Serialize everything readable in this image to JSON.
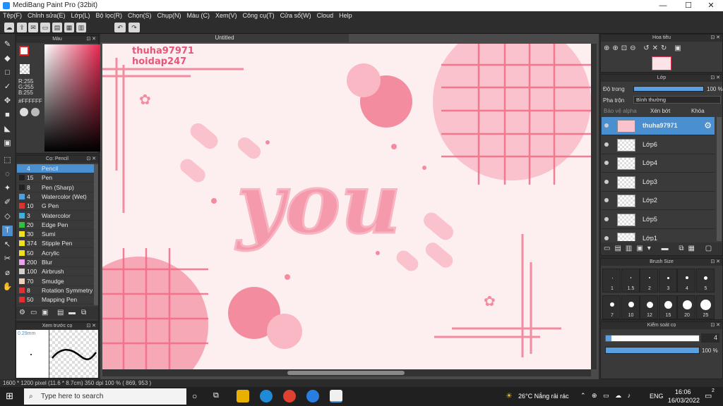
{
  "window": {
    "title": "MediBang Paint Pro (32bit)",
    "min": "—",
    "max": "☐",
    "close": "✕"
  },
  "menu": [
    "Tệp(F)",
    "Chỉnh sửa(E)",
    "Lớp(L)",
    "Bộ lọc(R)",
    "Chọn(S)",
    "Chụp(N)",
    "Màu (C)",
    "Xem(V)",
    "Công cụ(T)",
    "Cửa sổ(W)",
    "Cloud",
    "Help"
  ],
  "panels": {
    "color": {
      "title": "Màu",
      "r": "R:255",
      "g": "G:255",
      "b": "B:255",
      "hex": "#FFFFFF"
    },
    "brush": {
      "title": "Cọ: Pencil"
    },
    "preview": {
      "title": "Xem trước cọ",
      "size": "0.29mm"
    },
    "navigator": {
      "title": "Hoa tiêu"
    },
    "layer": {
      "title": "Lớp",
      "opacity_label": "Độ trong",
      "opacity_value": "100 %",
      "blend_label": "Pha trộn",
      "blend_value": "Bình thường",
      "protect_alpha": "Bảo vệ alpha",
      "clip": "Xén bớt",
      "lock": "Khóa"
    },
    "brushsize": {
      "title": "Brush Size"
    },
    "control": {
      "title": "Kiểm soát cọ",
      "size_value": "4",
      "opacity_value": "100 %"
    }
  },
  "brushes": [
    {
      "size": "4",
      "name": "Pencil",
      "color": "#4a90d0"
    },
    {
      "size": "15",
      "name": "Pen",
      "color": "#222222"
    },
    {
      "size": "8",
      "name": "Pen (Sharp)",
      "color": "#222222"
    },
    {
      "size": "4",
      "name": "Watercolor (Wet)",
      "color": "#4aa0e0"
    },
    {
      "size": "10",
      "name": "G Pen",
      "color": "#e03030"
    },
    {
      "size": "3",
      "name": "Watercolor",
      "color": "#40b0e0"
    },
    {
      "size": "20",
      "name": "Edge Pen",
      "color": "#30c040"
    },
    {
      "size": "30",
      "name": "Sumi",
      "color": "#f0e020"
    },
    {
      "size": "374",
      "name": "Stipple Pen",
      "color": "#f0e020"
    },
    {
      "size": "50",
      "name": "Acrylic",
      "color": "#f0e020"
    },
    {
      "size": "200",
      "name": "Blur",
      "color": "#f0a0f0"
    },
    {
      "size": "100",
      "name": "Airbrush",
      "color": "#d0d0d0"
    },
    {
      "size": "70",
      "name": "Smudge",
      "color": "#f0d0c0"
    },
    {
      "size": "8",
      "name": "Rotation Symmetry",
      "color": "#e03030"
    },
    {
      "size": "50",
      "name": "Mapping Pen",
      "color": "#e03030"
    }
  ],
  "document": {
    "tab": "Untitled",
    "watermark1": "thuha97971",
    "watermark2": "hoidap247",
    "lettering": "you"
  },
  "layers": [
    {
      "name": "thuha97971",
      "selected": true
    },
    {
      "name": "Lớp6",
      "selected": false
    },
    {
      "name": "Lớp4",
      "selected": false
    },
    {
      "name": "Lớp3",
      "selected": false
    },
    {
      "name": "Lớp2",
      "selected": false
    },
    {
      "name": "Lớp5",
      "selected": false
    },
    {
      "name": "Lớp1",
      "selected": false
    }
  ],
  "brush_sizes_row1": [
    "1",
    "1.5",
    "2",
    "3",
    "4",
    "5"
  ],
  "brush_sizes_row2": [
    "7",
    "10",
    "12",
    "15",
    "20",
    "25"
  ],
  "status": "1600 * 1200 pixel   (11.6 * 8.7cm)   350 dpi   100 %   ( 869, 953 )",
  "taskbar": {
    "search": "Type here to search",
    "weather": "26°C  Nắng rải rác",
    "lang": "ENG",
    "time": "16:06",
    "date": "16/03/2022",
    "notif": "2"
  },
  "colors": {
    "accent": "#4a90d0",
    "canvas_bg": "#fdeef0",
    "pink": "#f48ca0",
    "pink_light": "#f9b8c4"
  }
}
